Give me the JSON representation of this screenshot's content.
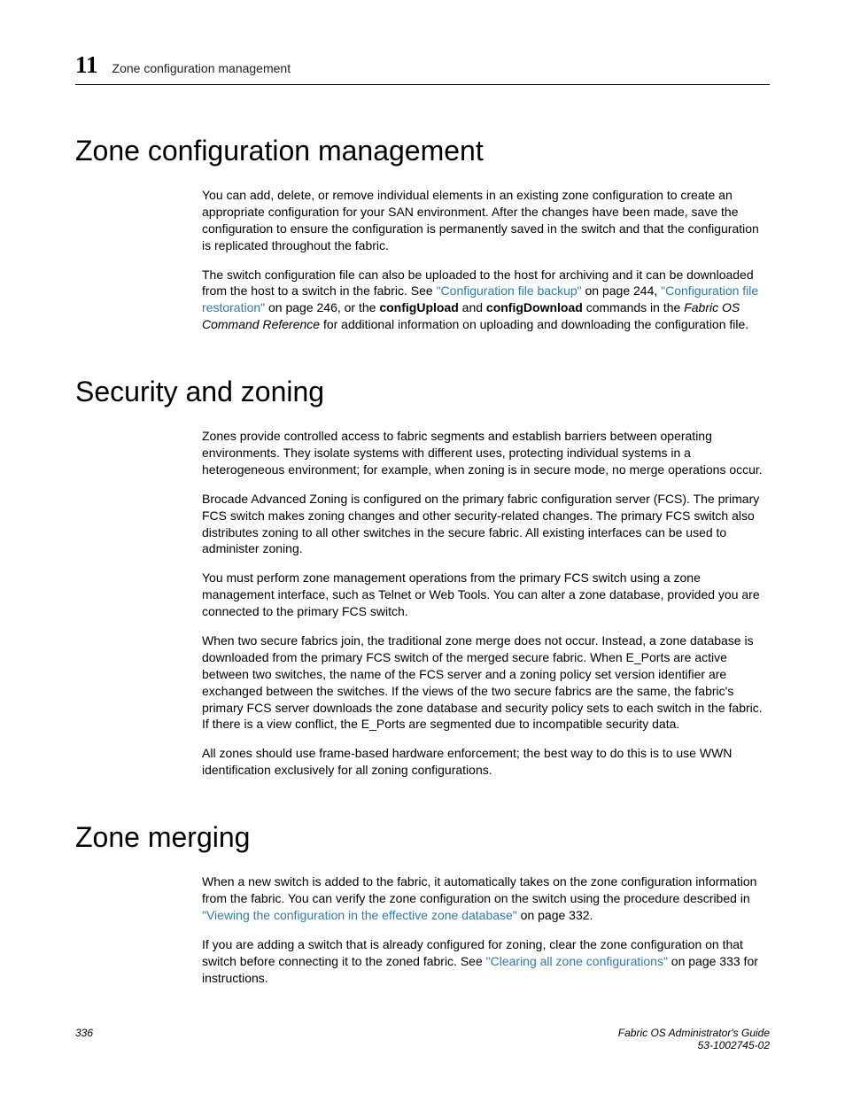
{
  "header": {
    "chapter_number": "11",
    "chapter_title": "Zone configuration management"
  },
  "sections": {
    "zone_config_mgmt": {
      "heading": "Zone configuration management",
      "p1": "You can add, delete, or remove individual elements in an existing zone configuration to create an appropriate configuration for your SAN environment. After the changes have been made, save the configuration to ensure the configuration is permanently saved in the switch and that the configuration is replicated throughout the fabric.",
      "p2_pre": "The switch configuration file can also be uploaded to the host for archiving and it can be downloaded from the host to a switch in the fabric. See ",
      "p2_link1": "\"Configuration file backup\"",
      "p2_mid1": " on page 244, ",
      "p2_link2": "\"Configuration file restoration\"",
      "p2_mid2": " on page 246, or the ",
      "p2_cmd1": "configUpload",
      "p2_mid3": " and ",
      "p2_cmd2": "configDownload",
      "p2_mid4": " commands in the ",
      "p2_ref": "Fabric OS Command Reference",
      "p2_end": " for additional information on uploading and downloading the configuration file."
    },
    "security_zoning": {
      "heading": "Security and zoning",
      "p1": "Zones provide controlled access to fabric segments and establish barriers between operating environments. They isolate systems with different uses, protecting individual systems in a heterogeneous environment; for example, when zoning is in secure mode, no merge operations occur.",
      "p2": "Brocade Advanced Zoning is configured on the primary fabric configuration server (FCS). The primary FCS switch makes zoning changes and other security-related changes. The primary FCS switch also distributes zoning to all other switches in the secure fabric. All existing interfaces can be used to administer zoning.",
      "p3": "You must perform zone management operations from the primary FCS switch using a zone management interface, such as Telnet or Web Tools. You can alter a zone database, provided you are connected to the primary FCS switch.",
      "p4": "When two secure fabrics join, the traditional zone merge does not occur. Instead, a zone database is downloaded from the primary FCS switch of the merged secure fabric. When E_Ports are active between two switches, the name of the FCS server and a zoning policy set version identifier are exchanged between the switches. If the views of the two secure fabrics are the same, the fabric's primary FCS server downloads the zone database and security policy sets to each switch in the fabric. If there is a view conflict, the E_Ports are segmented due to incompatible security data.",
      "p5": "All zones should use frame-based hardware enforcement; the best way to do this is to use WWN identification exclusively for all zoning configurations."
    },
    "zone_merging": {
      "heading": "Zone merging",
      "p1_pre": "When a new switch is added to the fabric, it automatically takes on the zone configuration information from the fabric. You can verify the zone configuration on the switch using the procedure described in ",
      "p1_link": "\"Viewing the configuration in the effective zone database\"",
      "p1_end": " on page 332.",
      "p2_pre": "If you are adding a switch that is already configured for zoning, clear the zone configuration on that switch before connecting it to the zoned fabric. See ",
      "p2_link": "\"Clearing all zone configurations\"",
      "p2_end": " on page 333 for instructions."
    }
  },
  "footer": {
    "page_number": "336",
    "guide_title": "Fabric OS Administrator's Guide",
    "doc_number": "53-1002745-02"
  }
}
